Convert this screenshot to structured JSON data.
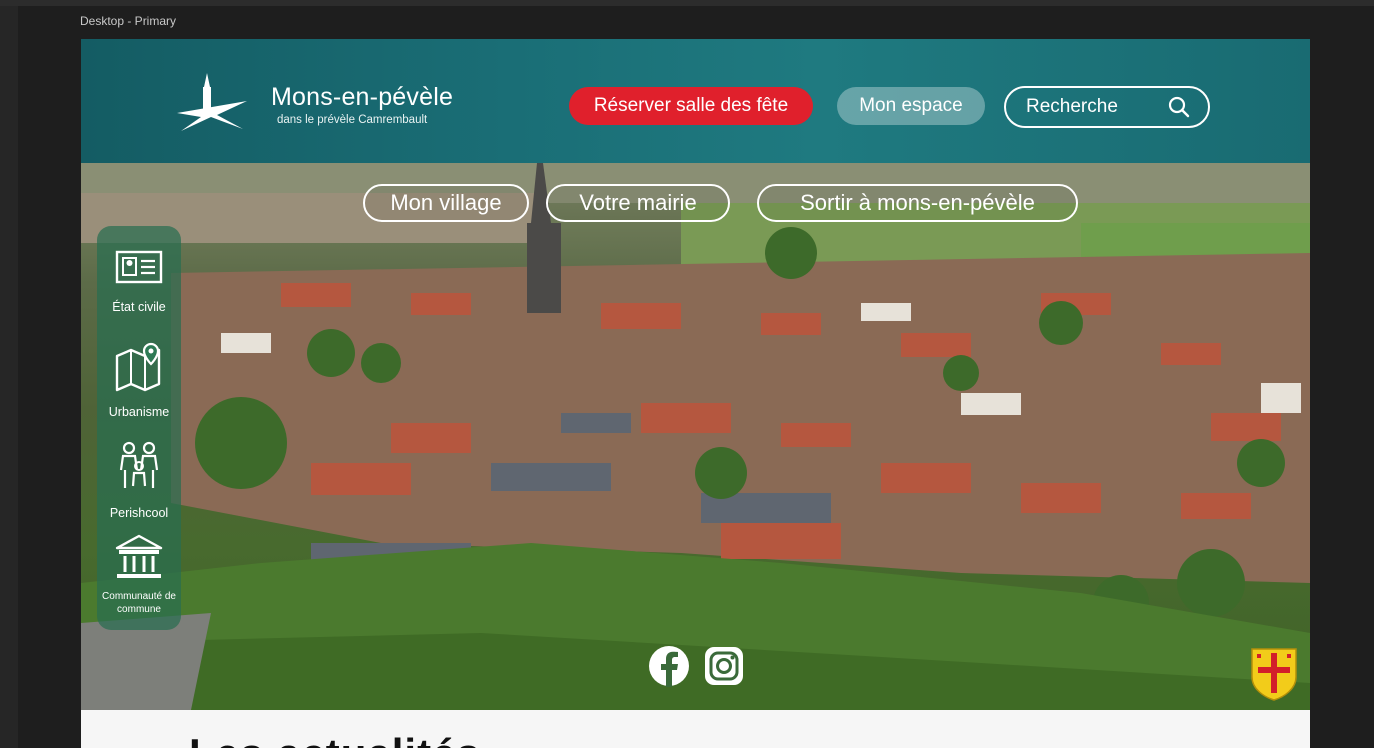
{
  "frame": {
    "label": "Desktop - Primary"
  },
  "header": {
    "site_name": "Mons-en-pévèle",
    "tagline": "dans le prévèle Camrembault",
    "reserve_label": "Réserver salle des fête",
    "espace_label": "Mon espace",
    "search_label": "Recherche"
  },
  "nav": {
    "items": [
      "Mon village",
      "Votre mairie",
      "Sortir à mons-en-pévèle"
    ]
  },
  "side_menu": {
    "items": [
      {
        "label": "État civile",
        "icon": "id-card-icon"
      },
      {
        "label": "Urbanisme",
        "icon": "map-pin-icon"
      },
      {
        "label": "Perishcool",
        "icon": "family-icon"
      },
      {
        "label": "Communauté de commune",
        "icon": "town-hall-icon"
      }
    ]
  },
  "social": [
    "facebook-icon",
    "instagram-icon"
  ],
  "news": {
    "title": "Les actualités"
  },
  "colors": {
    "header_bg": "#1a6e76",
    "reserve_red": "#e0202c",
    "side_menu_green": "#2e7a55"
  }
}
